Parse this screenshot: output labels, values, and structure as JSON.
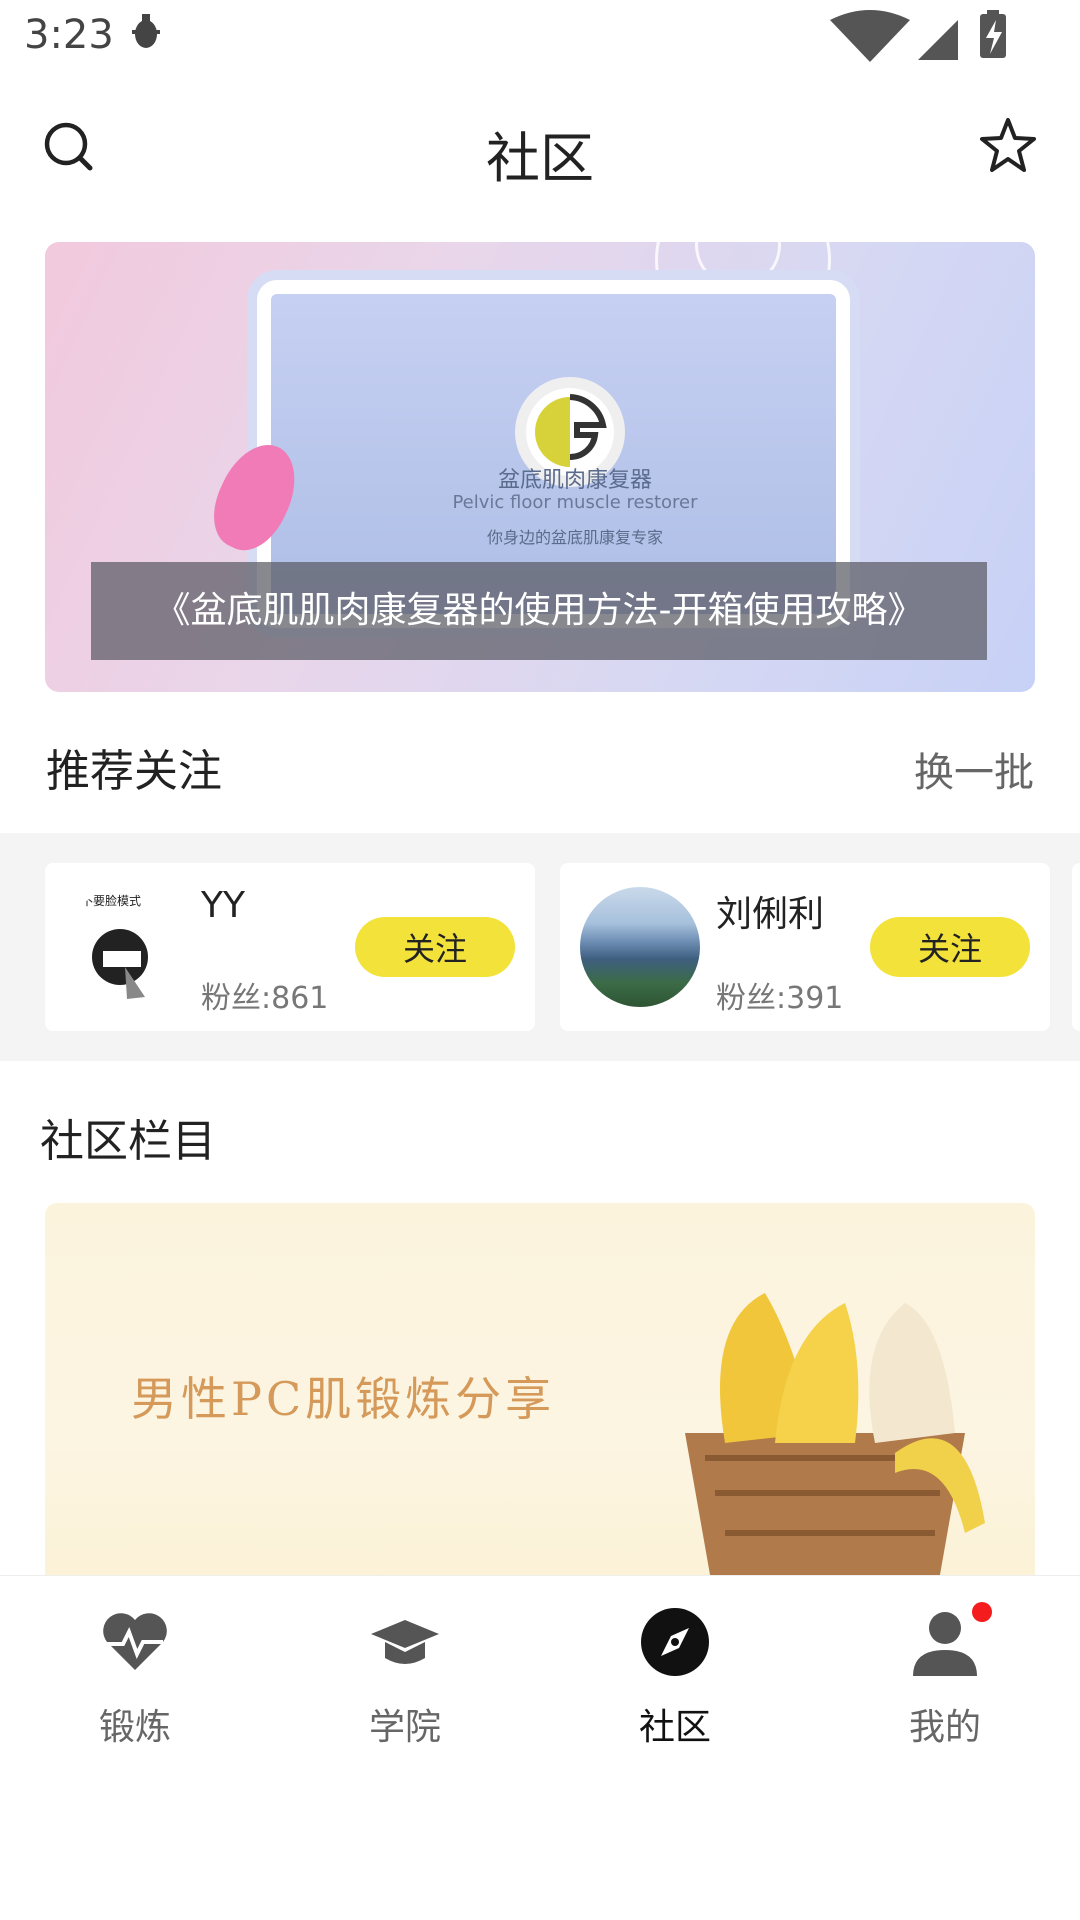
{
  "status_bar": {
    "time": "3:23"
  },
  "header": {
    "title": "社区"
  },
  "banner": {
    "caption": "《盆底肌肌肉康复器的使用方法-开箱使用攻略》",
    "product_name": "盆底肌肉康复器",
    "product_name_en": "Pelvic floor muscle restorer",
    "product_slogan": "你身边的盆底肌康复专家"
  },
  "recommend": {
    "title": "推荐关注",
    "refresh_label": "换一批",
    "users": [
      {
        "name": "YY",
        "fans": "粉丝:861",
        "follow_label": "关注"
      },
      {
        "name": "刘俐利",
        "fans": "粉丝:391",
        "follow_label": "关注"
      }
    ]
  },
  "columns": {
    "title": "社区栏目",
    "items": [
      {
        "label": "男性PC肌锻炼分享"
      }
    ]
  },
  "bottom_nav": {
    "items": [
      {
        "label": "锻炼",
        "icon": "heart-pulse-icon"
      },
      {
        "label": "学院",
        "icon": "graduation-cap-icon"
      },
      {
        "label": "社区",
        "icon": "compass-icon",
        "active": true
      },
      {
        "label": "我的",
        "icon": "user-icon",
        "badge": true
      }
    ]
  },
  "colors": {
    "accent_yellow": "#f2e23a",
    "badge_red": "#f41c1c"
  }
}
